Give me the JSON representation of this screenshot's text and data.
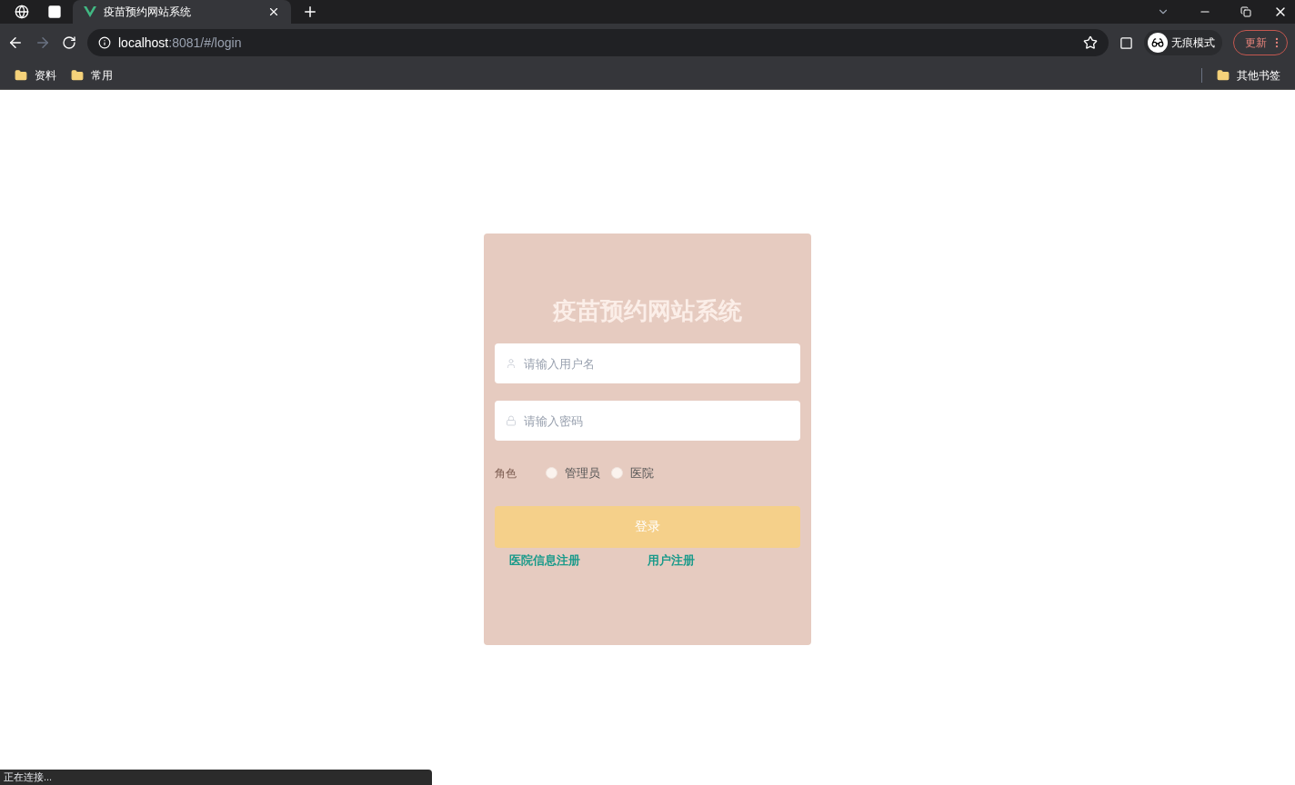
{
  "browser": {
    "tab": {
      "title": "疫苗预约网站系统",
      "selected": true
    },
    "address": {
      "host": "localhost",
      "path": ":8081/#/login"
    },
    "profile": {
      "label": "无痕模式"
    },
    "update_button": "更新",
    "bookmarks": [
      {
        "label": "资料"
      },
      {
        "label": "常用"
      }
    ],
    "other_bookmarks": "其他书签",
    "status": "正在连接..."
  },
  "login": {
    "title": "疫苗预约网站系统",
    "username": {
      "placeholder": "请输入用户名"
    },
    "password": {
      "placeholder": "请输入密码"
    },
    "role_label": "角色",
    "roles": [
      {
        "label": "管理员",
        "selected": false
      },
      {
        "label": "医院",
        "selected": false
      }
    ],
    "submit": "登录",
    "links": [
      "医院信息注册",
      "用户注册"
    ]
  }
}
